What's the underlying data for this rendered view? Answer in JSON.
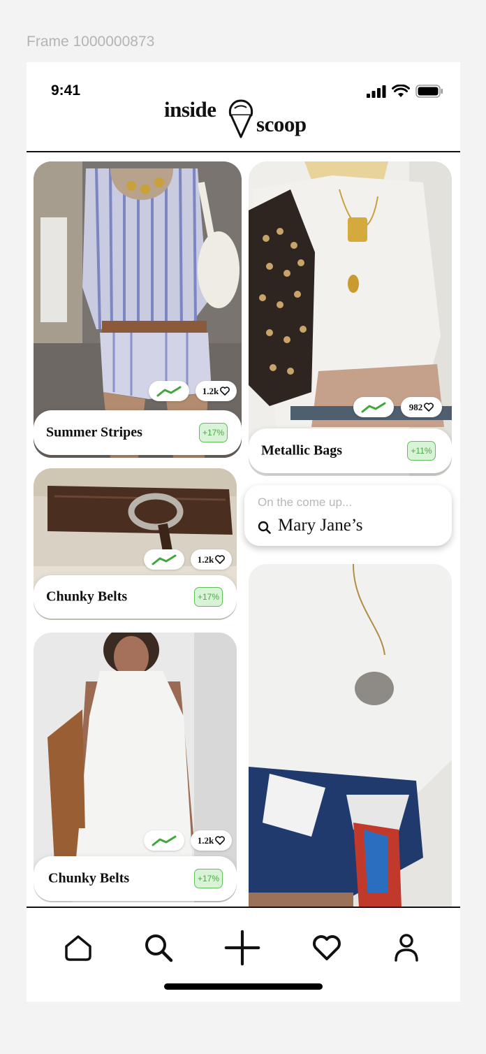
{
  "frame_label": "Frame 1000000873",
  "status": {
    "time": "9:41"
  },
  "logo": {
    "word1": "inside",
    "word2": "scoop",
    "icon": "ice-cream-cone-icon"
  },
  "cards": [
    {
      "title": "Summer Stripes",
      "change": "+17%",
      "likes": "1.2k"
    },
    {
      "title": "Chunky Belts",
      "change": "+17%",
      "likes": "1.2k"
    },
    {
      "title": "Chunky Belts",
      "change": "+17%",
      "likes": "1.2k"
    },
    {
      "title": "Metallic Bags",
      "change": "+11%",
      "likes": "982"
    }
  ],
  "search_card": {
    "subtitle": "On the come up...",
    "query": "Mary Jane’s"
  },
  "nav": {
    "items": [
      "home-icon",
      "search-icon",
      "plus-icon",
      "heart-icon",
      "profile-icon"
    ]
  },
  "colors": {
    "accent_green": "#4aa845",
    "badge_bg": "#d9f3d6",
    "trend_line": "#3fa83a"
  }
}
